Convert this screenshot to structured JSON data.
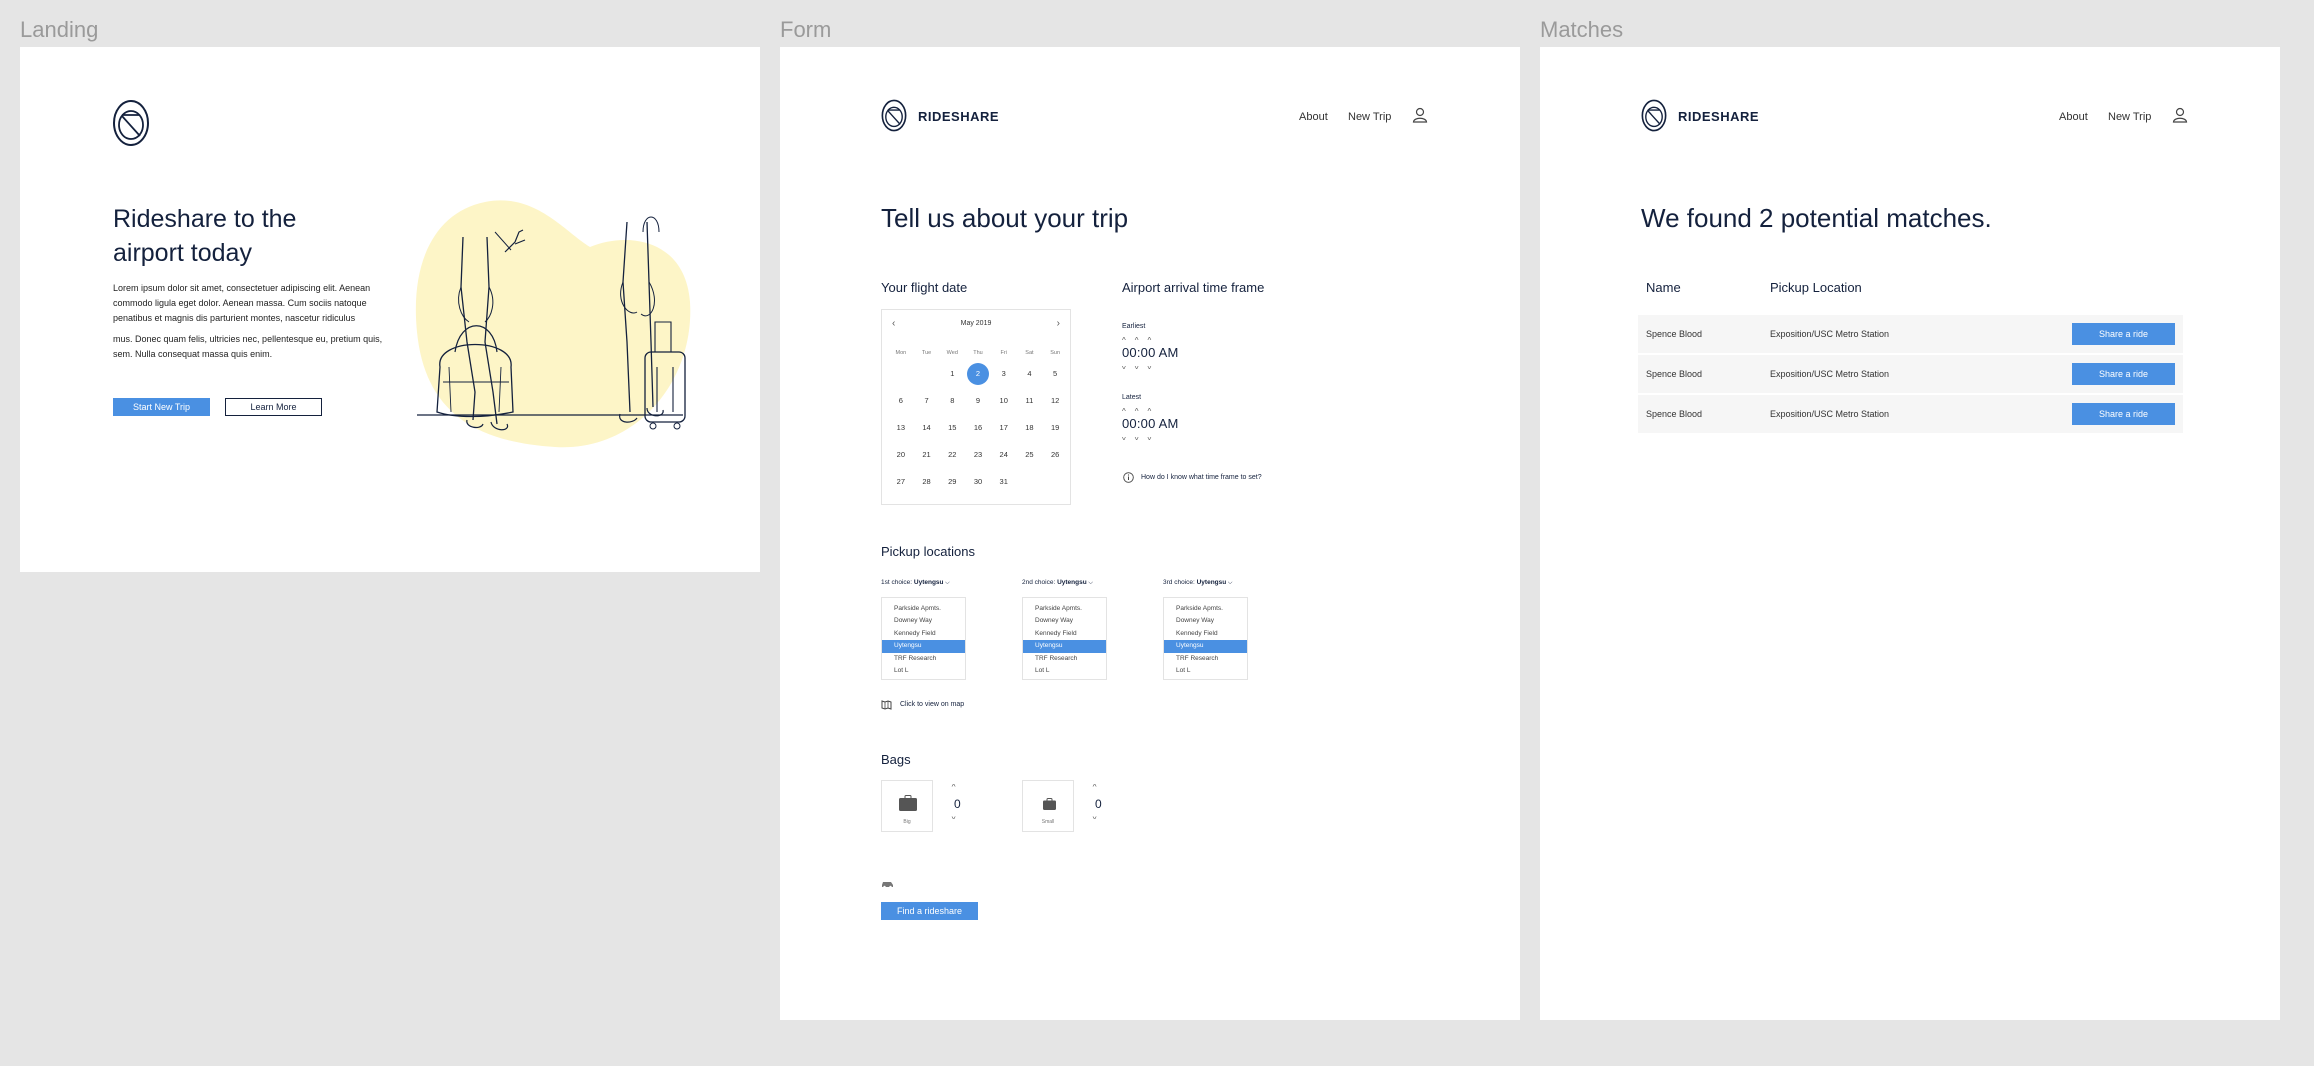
{
  "frames": {
    "landing": "Landing",
    "form": "Form",
    "matches": "Matches"
  },
  "brand": {
    "name": "RIDESHARE"
  },
  "nav": {
    "about": "About",
    "new_trip": "New Trip"
  },
  "landing": {
    "title_line1": "Rideshare to the",
    "title_line2": "airport today",
    "body1_line1": "Lorem ipsum dolor sit amet, consectetuer adipiscing elit. Aenean",
    "body1_line2": "commodo ligula eget dolor. Aenean massa. Cum sociis natoque",
    "body1_line3": "penatibus et magnis dis parturient montes, nascetur ridiculus",
    "body2_line1": "mus. Donec quam felis, ultricies nec, pellentesque eu, pretium quis,",
    "body2_line2": "sem. Nulla consequat massa quis enim.",
    "start_button": "Start New Trip",
    "learn_button": "Learn More"
  },
  "form": {
    "title": "Tell us about your trip",
    "flight_date_heading": "Your flight date",
    "arrival_heading": "Airport arrival time frame",
    "calendar": {
      "month": "May 2019",
      "prev": "‹",
      "next": "›",
      "weekdays": [
        "Mon",
        "Tue",
        "Wed",
        "Thu",
        "Fri",
        "Sat",
        "Sun"
      ],
      "days": [
        "",
        "",
        "1",
        "2",
        "3",
        "4",
        "5",
        "6",
        "7",
        "8",
        "9",
        "10",
        "11",
        "12",
        "13",
        "14",
        "15",
        "16",
        "17",
        "18",
        "19",
        "20",
        "21",
        "22",
        "23",
        "24",
        "25",
        "26",
        "27",
        "28",
        "29",
        "30",
        "31"
      ],
      "selected": "2"
    },
    "earliest_label": "Earliest",
    "earliest_value": "00:00 AM",
    "latest_label": "Latest",
    "latest_value": "00:00 AM",
    "help_text": "How do I know what time frame to set?",
    "pickup_heading": "Pickup locations",
    "choices": [
      {
        "label": "1st choice: ",
        "value": "Uytengsu"
      },
      {
        "label": "2nd choice: ",
        "value": "Uytengsu"
      },
      {
        "label": "3rd choice: ",
        "value": "Uytengsu"
      }
    ],
    "locations": [
      "Parkside Apmts.",
      "Downey Way",
      "Kennedy Field",
      "Uytengsu",
      "TRF Research",
      "Lot L"
    ],
    "selected_location": "Uytengsu",
    "map_link": "Click to view on map",
    "bags_heading": "Bags",
    "bags": [
      {
        "label": "Big",
        "count": "0"
      },
      {
        "label": "Small",
        "count": "0"
      }
    ],
    "find_button": "Find a rideshare"
  },
  "matches": {
    "title": "We found 2 potential matches.",
    "columns": [
      "Name",
      "Pickup Location"
    ],
    "rows": [
      {
        "name": "Spence Blood",
        "location": "Exposition/USC Metro Station",
        "action": "Share a ride"
      },
      {
        "name": "Spence Blood",
        "location": "Exposition/USC Metro Station",
        "action": "Share a ride"
      },
      {
        "name": "Spence Blood",
        "location": "Exposition/USC Metro Station",
        "action": "Share a ride"
      }
    ]
  },
  "colors": {
    "accent": "#4a90e2",
    "navy": "#14213d",
    "blob": "#fdf5c7",
    "canvas": "#e5e5e5"
  }
}
